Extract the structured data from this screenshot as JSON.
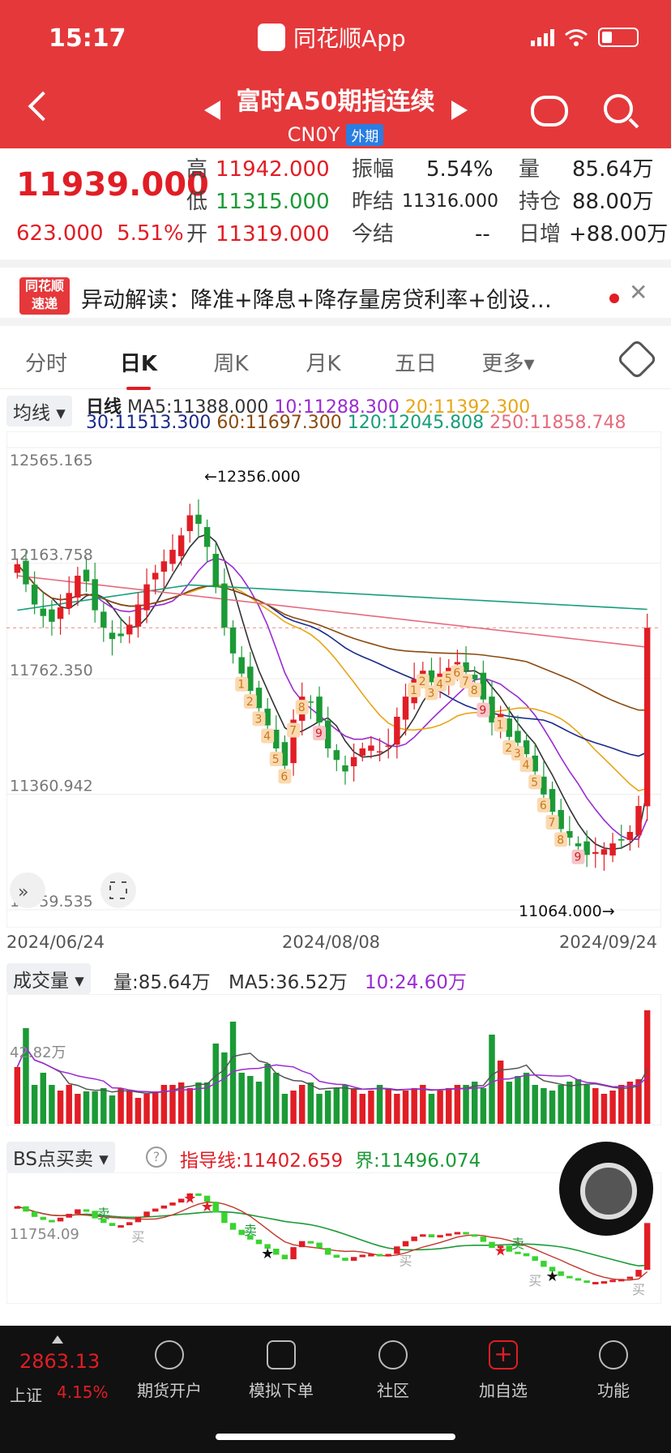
{
  "status_bar": {
    "time": "15:17",
    "app_name": "同花顺App"
  },
  "header": {
    "title": "富时A50期指连续",
    "code": "CN0Y",
    "market_badge": "外期"
  },
  "quote": {
    "last": "11939.000",
    "change": "623.000",
    "change_pct": "5.51%",
    "high_label": "高",
    "high": "11942.000",
    "low_label": "低",
    "low": "11315.000",
    "open_label": "开",
    "open": "11319.000",
    "amp_label": "振幅",
    "amp": "5.54%",
    "prev_settle_label": "昨结",
    "prev_settle": "11316.000",
    "settle_label": "今结",
    "settle": "--",
    "vol_label": "量",
    "vol": "85.64万",
    "oi_label": "持仓",
    "oi": "88.00万",
    "oi_chg_label": "日增",
    "oi_chg": "+88.00万"
  },
  "news": {
    "logo_top": "同花顺",
    "logo_bottom": "速递",
    "text": "异动解读：降准+降息+降存量房贷利率+创设…"
  },
  "tabs": [
    "分时",
    "日K",
    "周K",
    "月K",
    "五日",
    "更多▾"
  ],
  "ma": {
    "dropdown": "均线 ▾",
    "period": "日线",
    "ma5": "MA5:11388.000",
    "ma10": "10:11288.300",
    "ma20": "20:11392.300",
    "ma30": "30:11513.300",
    "ma60": "60:11697.300",
    "ma120": "120:12045.808",
    "ma250": "250:11858.748"
  },
  "chart_data": [
    {
      "type": "candlestick",
      "y_ticks": [
        "12565.165",
        "12163.758",
        "11762.350",
        "11360.942",
        "10959.535"
      ],
      "ylim": [
        10959.535,
        12565.165
      ],
      "x_ticks": [
        "2024/06/24",
        "2024/08/08",
        "2024/09/24"
      ],
      "annotations": [
        "←12356.000",
        "11064.000→"
      ],
      "td_marks": [
        "1",
        "2",
        "3",
        "4",
        "5",
        "6",
        "7",
        "8",
        "9",
        "1",
        "2",
        "3",
        "4",
        "5",
        "6",
        "7",
        "8",
        "9",
        "1",
        "2",
        "3",
        "4",
        "5",
        "6",
        "7",
        "8",
        "9"
      ],
      "closes": [
        12160,
        12090,
        12020,
        11980,
        11960,
        12010,
        12060,
        12120,
        12100,
        12000,
        11940,
        11900,
        11910,
        11950,
        12020,
        12090,
        12130,
        12170,
        12210,
        12260,
        12330,
        12300,
        12220,
        12080,
        11940,
        11850,
        11780,
        11720,
        11660,
        11600,
        11520,
        11460,
        11620,
        11700,
        11680,
        11610,
        11520,
        11480,
        11440,
        11490,
        11520,
        11530,
        11510,
        11530,
        11630,
        11700,
        11760,
        11790,
        11750,
        11780,
        11800,
        11820,
        11790,
        11760,
        11690,
        11610,
        11640,
        11560,
        11540,
        11500,
        11440,
        11360,
        11300,
        11240,
        11210,
        11180,
        11150,
        11160,
        11170,
        11190,
        11200,
        11230,
        11320,
        11939
      ]
    },
    {
      "type": "bar",
      "title": "成交量",
      "series": [
        {
          "name": "量",
          "values": [
            70,
            118,
            48,
            63,
            48,
            41,
            48,
            37,
            40,
            40,
            44,
            35,
            44,
            40,
            32,
            37,
            40,
            48,
            48,
            51,
            44,
            51,
            51,
            99,
            88,
            126,
            63,
            59,
            52,
            74,
            63,
            37,
            41,
            48,
            51,
            37,
            41,
            44,
            48,
            44,
            37,
            41,
            48,
            44,
            37,
            41,
            44,
            48,
            37,
            41,
            44,
            48,
            48,
            52,
            44,
            110,
            78,
            52,
            59,
            63,
            48,
            44,
            41,
            48,
            52,
            55,
            48,
            44,
            37,
            41,
            48,
            52,
            55,
            140
          ]
        }
      ],
      "labels": {
        "vol": "量:85.64万",
        "ma5": "MA5:36.52万",
        "ma10": "10:24.60万",
        "ytick": "42.82万"
      }
    }
  ],
  "volume": {
    "dropdown": "成交量 ▾",
    "vol": "量:85.64万",
    "ma5": "MA5:36.52万",
    "ma10": "10:24.60万",
    "ytick": "42.82万"
  },
  "bs": {
    "dropdown": "BS点买卖 ▾",
    "help": "?",
    "guide": "指导线:11402.659",
    "bound": "界:11496.074",
    "ytick": "11754.09",
    "sell": "卖",
    "buy": "买"
  },
  "bottom_nav": {
    "index_value": "2863.13",
    "index_name": "上证",
    "index_pct": "4.15%",
    "items": [
      "期货开户",
      "模拟下单",
      "社区",
      "加自选",
      "功能"
    ]
  },
  "colors": {
    "up": "#e11d25",
    "down": "#1b9a36",
    "header": "#e5383b"
  }
}
